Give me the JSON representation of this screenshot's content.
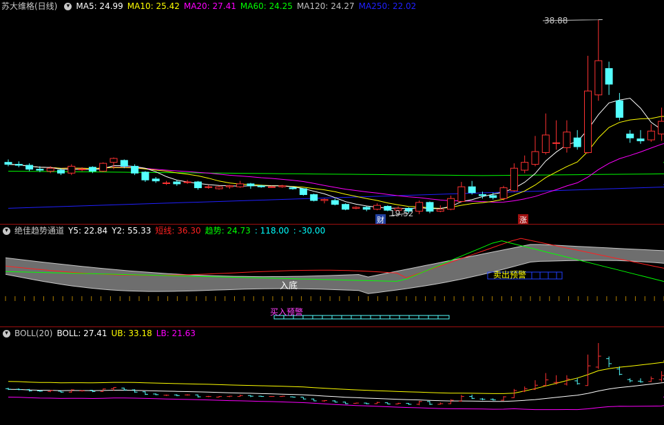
{
  "main": {
    "stock_name": "苏大维格(日线)",
    "ma_items": [
      {
        "label": "MA5: 24.99",
        "color": "#ffffff"
      },
      {
        "label": "MA10: 25.42",
        "color": "#ffff00"
      },
      {
        "label": "MA20: 27.41",
        "color": "#ff00ff"
      },
      {
        "label": "MA60: 24.25",
        "color": "#00ff00"
      },
      {
        "label": "MA120: 24.27",
        "color": "#c0c0c0"
      },
      {
        "label": "MA250: 22.02",
        "color": "#2020ff"
      }
    ],
    "high_label": "38.88",
    "low_label": "19.52",
    "marker_cai": "财",
    "marker_zhang": "涨",
    "price_range": [
      18.5,
      39.5
    ],
    "candles": [
      [
        24.3,
        24.1,
        24.6,
        23.9
      ],
      [
        24.1,
        24.0,
        24.4,
        23.8
      ],
      [
        24.0,
        23.6,
        24.2,
        23.4
      ],
      [
        23.6,
        23.5,
        23.9,
        23.3
      ],
      [
        23.4,
        23.7,
        23.9,
        23.2
      ],
      [
        23.5,
        23.2,
        23.7,
        23.0
      ],
      [
        23.2,
        23.9,
        24.1,
        23.0
      ],
      [
        23.6,
        23.6,
        23.8,
        23.4
      ],
      [
        23.8,
        23.4,
        23.9,
        23.2
      ],
      [
        23.4,
        24.2,
        24.3,
        23.3
      ],
      [
        24.3,
        24.7,
        24.8,
        23.6
      ],
      [
        24.5,
        23.9,
        24.6,
        23.7
      ],
      [
        23.9,
        23.2,
        24.1,
        23.0
      ],
      [
        23.3,
        22.5,
        23.4,
        22.3
      ],
      [
        22.6,
        22.4,
        22.8,
        22.2
      ],
      [
        22.2,
        22.2,
        22.4,
        22.0
      ],
      [
        22.3,
        22.1,
        22.5,
        21.9
      ],
      [
        22.3,
        22.3,
        22.5,
        22.1
      ],
      [
        22.3,
        21.7,
        22.4,
        21.5
      ],
      [
        21.8,
        21.8,
        22.0,
        21.6
      ],
      [
        21.6,
        21.8,
        21.9,
        21.5
      ],
      [
        21.8,
        21.9,
        22.0,
        21.6
      ],
      [
        21.8,
        22.1,
        22.4,
        21.7
      ],
      [
        22.1,
        21.9,
        22.2,
        21.6
      ],
      [
        21.9,
        21.8,
        22.0,
        21.7
      ],
      [
        21.8,
        21.8,
        21.9,
        21.7
      ],
      [
        21.8,
        21.9,
        22.0,
        21.7
      ],
      [
        21.7,
        21.6,
        21.8,
        21.5
      ],
      [
        21.6,
        21.0,
        21.6,
        20.9
      ],
      [
        21.0,
        20.4,
        21.1,
        20.3
      ],
      [
        20.4,
        20.5,
        20.6,
        20.1
      ],
      [
        20.4,
        20.0,
        20.6,
        19.9
      ],
      [
        20.0,
        19.5,
        20.1,
        19.4
      ],
      [
        19.6,
        19.7,
        19.8,
        19.5
      ],
      [
        19.7,
        19.5,
        19.8,
        19.3
      ],
      [
        19.5,
        19.9,
        20.1,
        19.4
      ],
      [
        19.8,
        19.4,
        19.9,
        19.3
      ],
      [
        19.4,
        19.6,
        19.8,
        19.3
      ],
      [
        19.6,
        19.3,
        19.7,
        19.1
      ],
      [
        19.3,
        20.2,
        20.4,
        19.0
      ],
      [
        20.2,
        19.3,
        20.3,
        19.1
      ],
      [
        19.3,
        19.5,
        19.9,
        19.2
      ],
      [
        19.5,
        20.6,
        20.9,
        19.4
      ],
      [
        20.3,
        21.8,
        22.3,
        20.2
      ],
      [
        21.8,
        21.2,
        22.4,
        21.0
      ],
      [
        21.0,
        20.9,
        21.3,
        20.6
      ],
      [
        20.9,
        20.7,
        21.2,
        20.5
      ],
      [
        20.6,
        21.7,
        21.9,
        20.4
      ],
      [
        21.4,
        23.7,
        24.2,
        21.3
      ],
      [
        23.5,
        24.3,
        25.0,
        23.2
      ],
      [
        24.1,
        25.4,
        27.0,
        23.9
      ],
      [
        25.3,
        27.1,
        29.3,
        25.1
      ],
      [
        26.3,
        26.3,
        28.6,
        25.6
      ],
      [
        25.8,
        27.4,
        28.6,
        25.3
      ],
      [
        26.8,
        25.9,
        27.6,
        25.6
      ],
      [
        25.3,
        31.6,
        35.2,
        25.2
      ],
      [
        31.2,
        34.7,
        38.9,
        30.6
      ],
      [
        33.9,
        32.3,
        34.6,
        31.2
      ],
      [
        30.6,
        28.9,
        31.4,
        28.6
      ],
      [
        27.2,
        26.8,
        27.6,
        26.3
      ],
      [
        26.7,
        26.5,
        27.6,
        26.2
      ],
      [
        26.6,
        27.5,
        28.2,
        26.4
      ],
      [
        27.2,
        28.5,
        29.9,
        26.5
      ],
      [
        28.4,
        27.1,
        28.9,
        26.9
      ],
      [
        26.9,
        26.2,
        27.4,
        25.9
      ],
      [
        26.0,
        25.6,
        26.7,
        25.0
      ],
      [
        25.4,
        25.8,
        26.5,
        25.1
      ],
      [
        24.3,
        22.0,
        24.6,
        21.8
      ],
      [
        22.6,
        23.2,
        23.6,
        21.9
      ],
      [
        23.2,
        23.5,
        23.9,
        22.8
      ]
    ]
  },
  "indicator": {
    "name": "绝佳趋势通道",
    "params": [
      {
        "label": "Y5: 22.84",
        "color": "#ffffff"
      },
      {
        "label": "Y2: 55.33",
        "color": "#ffffff"
      },
      {
        "label": "短线: 36.30",
        "color": "#ff2020"
      },
      {
        "label": "趋势: 24.73",
        "color": "#00ff00"
      },
      {
        "label": ": 118.00",
        "color": "#00ffff"
      },
      {
        "label": ": -30.00",
        "color": "#00ffff"
      }
    ],
    "text_rudi": "入底",
    "text_buy_warning": "买入预警",
    "text_sell_warning": "卖出预警"
  },
  "boll": {
    "name": "BOLL(20)",
    "params": [
      {
        "label": "BOLL: 27.41",
        "color": "#ffffff"
      },
      {
        "label": "UB: 33.18",
        "color": "#ffff00"
      },
      {
        "label": "LB: 21.63",
        "color": "#ff00ff"
      }
    ]
  },
  "colors": {
    "up": "#ff3232",
    "down": "#54ffff",
    "separator": "#a01010"
  }
}
